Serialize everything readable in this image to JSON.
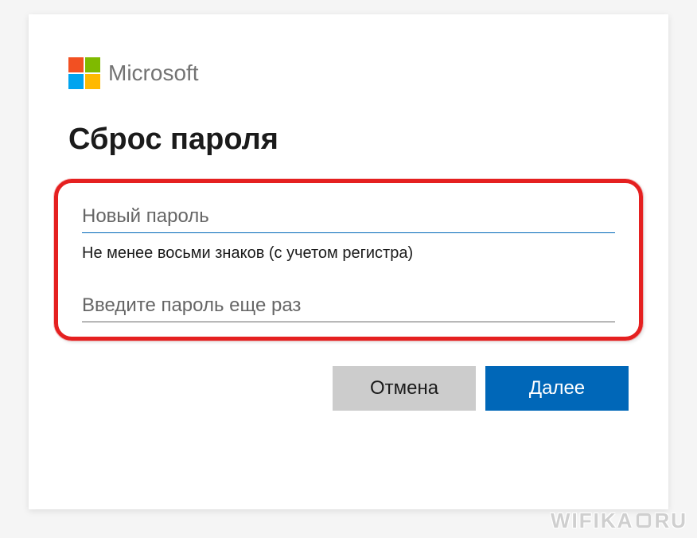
{
  "brand": {
    "name": "Microsoft",
    "colors": {
      "red": "#f25022",
      "green": "#7fba00",
      "blue": "#00a4ef",
      "yellow": "#ffb900"
    }
  },
  "heading": "Сброс пароля",
  "form": {
    "new_password": {
      "placeholder": "Новый пароль",
      "value": ""
    },
    "hint": "Не менее восьми знаков (с учетом регистра)",
    "confirm_password": {
      "placeholder": "Введите пароль еще раз",
      "value": ""
    }
  },
  "buttons": {
    "cancel": "Отмена",
    "next": "Далее"
  },
  "watermark": {
    "part1": "WIFIKA",
    "part2": "RU"
  }
}
